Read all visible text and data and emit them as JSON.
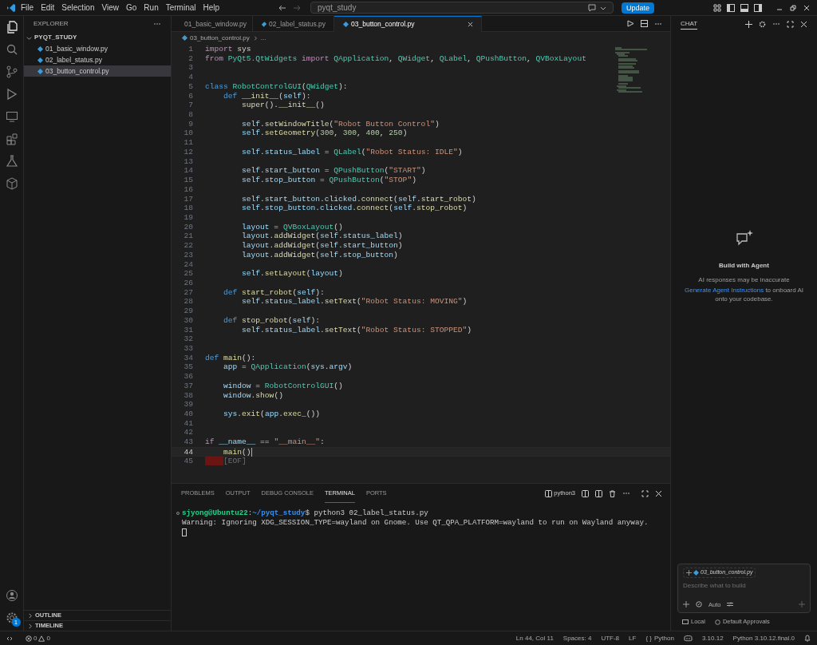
{
  "menu": [
    "File",
    "Edit",
    "Selection",
    "View",
    "Go",
    "Run",
    "Terminal",
    "Help"
  ],
  "search": {
    "value": "pyqt_study"
  },
  "update_button": "Update",
  "explorer": {
    "title": "EXPLORER",
    "folder": "PYQT_STUDY",
    "files": [
      {
        "name": "01_basic_window.py",
        "selected": false
      },
      {
        "name": "02_label_status.py",
        "selected": false
      },
      {
        "name": "03_button_control.py",
        "selected": true
      }
    ],
    "sections": [
      "OUTLINE",
      "TIMELINE"
    ]
  },
  "settings_badge": "1",
  "tabs": [
    {
      "label": "01_basic_window.py",
      "selected": false
    },
    {
      "label": "02_label_status.py",
      "selected": false
    },
    {
      "label": "03_button_control.py",
      "selected": true
    }
  ],
  "breadcrumb": [
    "03_button_control.py",
    "..."
  ],
  "code": [
    {
      "n": "1",
      "tokens": [
        {
          "kind": "kw",
          "text": "import"
        },
        {
          "kind": "pl",
          "text": " sys"
        }
      ]
    },
    {
      "n": "2",
      "tokens": [
        {
          "kind": "kw",
          "text": "from"
        },
        {
          "kind": "cl",
          "text": " PyQt5.QtWidgets "
        },
        {
          "kind": "kw",
          "text": "import"
        },
        {
          "kind": "cl",
          "text": " QApplication"
        },
        {
          "kind": "pl",
          "text": ", "
        },
        {
          "kind": "cl",
          "text": "QWidget"
        },
        {
          "kind": "pl",
          "text": ", "
        },
        {
          "kind": "cl",
          "text": "QLabel"
        },
        {
          "kind": "pl",
          "text": ", "
        },
        {
          "kind": "cl",
          "text": "QPushButton"
        },
        {
          "kind": "pl",
          "text": ", "
        },
        {
          "kind": "cl",
          "text": "QVBoxLayout"
        }
      ]
    },
    {
      "n": "3"
    },
    {
      "n": "4"
    },
    {
      "n": "5",
      "tokens": [
        {
          "kind": "st",
          "text": "class"
        },
        {
          "kind": "cl",
          "text": " RobotControlGUI"
        },
        {
          "kind": "pl",
          "text": "("
        },
        {
          "kind": "cl",
          "text": "QWidget"
        },
        {
          "kind": "pl",
          "text": "):"
        }
      ]
    },
    {
      "n": "6",
      "tokens": [
        {
          "kind": "st",
          "text": "    def"
        },
        {
          "kind": "fn",
          "text": " __init__"
        },
        {
          "kind": "pl",
          "text": "("
        },
        {
          "kind": "var",
          "text": "self"
        },
        {
          "kind": "pl",
          "text": "):"
        }
      ]
    },
    {
      "n": "7",
      "tokens": [
        {
          "kind": "fn",
          "text": "        super"
        },
        {
          "kind": "pl",
          "text": "()."
        },
        {
          "kind": "fn",
          "text": "__init__"
        },
        {
          "kind": "pl",
          "text": "()"
        }
      ]
    },
    {
      "n": "8"
    },
    {
      "n": "9",
      "tokens": [
        {
          "kind": "var",
          "text": "        self"
        },
        {
          "kind": "pl",
          "text": "."
        },
        {
          "kind": "fn",
          "text": "setWindowTitle"
        },
        {
          "kind": "pl",
          "text": "("
        },
        {
          "kind": "str",
          "text": "\"Robot Button Control\""
        },
        {
          "kind": "pl",
          "text": ")"
        }
      ]
    },
    {
      "n": "10",
      "tokens": [
        {
          "kind": "var",
          "text": "        self"
        },
        {
          "kind": "pl",
          "text": "."
        },
        {
          "kind": "fn",
          "text": "setGeometry"
        },
        {
          "kind": "pl",
          "text": "("
        },
        {
          "kind": "num",
          "text": "300"
        },
        {
          "kind": "pl",
          "text": ", "
        },
        {
          "kind": "num",
          "text": "300"
        },
        {
          "kind": "pl",
          "text": ", "
        },
        {
          "kind": "num",
          "text": "400"
        },
        {
          "kind": "pl",
          "text": ", "
        },
        {
          "kind": "num",
          "text": "250"
        },
        {
          "kind": "pl",
          "text": ")"
        }
      ]
    },
    {
      "n": "11"
    },
    {
      "n": "12",
      "tokens": [
        {
          "kind": "var",
          "text": "        self"
        },
        {
          "kind": "pl",
          "text": "."
        },
        {
          "kind": "var",
          "text": "status_label"
        },
        {
          "kind": "pl",
          "text": " = "
        },
        {
          "kind": "cl",
          "text": "QLabel"
        },
        {
          "kind": "pl",
          "text": "("
        },
        {
          "kind": "str",
          "text": "\"Robot Status: IDLE\""
        },
        {
          "kind": "pl",
          "text": ")"
        }
      ]
    },
    {
      "n": "13"
    },
    {
      "n": "14",
      "tokens": [
        {
          "kind": "var",
          "text": "        self"
        },
        {
          "kind": "pl",
          "text": "."
        },
        {
          "kind": "var",
          "text": "start_button"
        },
        {
          "kind": "pl",
          "text": " = "
        },
        {
          "kind": "cl",
          "text": "QPushButton"
        },
        {
          "kind": "pl",
          "text": "("
        },
        {
          "kind": "str",
          "text": "\"START\""
        },
        {
          "kind": "pl",
          "text": ")"
        }
      ]
    },
    {
      "n": "15",
      "tokens": [
        {
          "kind": "var",
          "text": "        self"
        },
        {
          "kind": "pl",
          "text": "."
        },
        {
          "kind": "var",
          "text": "stop_button"
        },
        {
          "kind": "pl",
          "text": " = "
        },
        {
          "kind": "cl",
          "text": "QPushButton"
        },
        {
          "kind": "pl",
          "text": "("
        },
        {
          "kind": "str",
          "text": "\"STOP\""
        },
        {
          "kind": "pl",
          "text": ")"
        }
      ]
    },
    {
      "n": "16"
    },
    {
      "n": "17",
      "tokens": [
        {
          "kind": "var",
          "text": "        self"
        },
        {
          "kind": "pl",
          "text": "."
        },
        {
          "kind": "var",
          "text": "start_button"
        },
        {
          "kind": "pl",
          "text": "."
        },
        {
          "kind": "var",
          "text": "clicked"
        },
        {
          "kind": "pl",
          "text": "."
        },
        {
          "kind": "fn",
          "text": "connect"
        },
        {
          "kind": "pl",
          "text": "("
        },
        {
          "kind": "var",
          "text": "self"
        },
        {
          "kind": "pl",
          "text": "."
        },
        {
          "kind": "fn",
          "text": "start_robot"
        },
        {
          "kind": "pl",
          "text": ")"
        }
      ]
    },
    {
      "n": "18",
      "tokens": [
        {
          "kind": "var",
          "text": "        self"
        },
        {
          "kind": "pl",
          "text": "."
        },
        {
          "kind": "var",
          "text": "stop_button"
        },
        {
          "kind": "pl",
          "text": "."
        },
        {
          "kind": "var",
          "text": "clicked"
        },
        {
          "kind": "pl",
          "text": "."
        },
        {
          "kind": "fn",
          "text": "connect"
        },
        {
          "kind": "pl",
          "text": "("
        },
        {
          "kind": "var",
          "text": "self"
        },
        {
          "kind": "pl",
          "text": "."
        },
        {
          "kind": "fn",
          "text": "stop_robot"
        },
        {
          "kind": "pl",
          "text": ")"
        }
      ]
    },
    {
      "n": "19"
    },
    {
      "n": "20",
      "tokens": [
        {
          "kind": "var",
          "text": "        layout"
        },
        {
          "kind": "pl",
          "text": " = "
        },
        {
          "kind": "cl",
          "text": "QVBoxLayout"
        },
        {
          "kind": "pl",
          "text": "()"
        }
      ]
    },
    {
      "n": "21",
      "tokens": [
        {
          "kind": "var",
          "text": "        layout"
        },
        {
          "kind": "pl",
          "text": "."
        },
        {
          "kind": "fn",
          "text": "addWidget"
        },
        {
          "kind": "pl",
          "text": "("
        },
        {
          "kind": "var",
          "text": "self"
        },
        {
          "kind": "pl",
          "text": "."
        },
        {
          "kind": "var",
          "text": "status_label"
        },
        {
          "kind": "pl",
          "text": ")"
        }
      ]
    },
    {
      "n": "22",
      "tokens": [
        {
          "kind": "var",
          "text": "        layout"
        },
        {
          "kind": "pl",
          "text": "."
        },
        {
          "kind": "fn",
          "text": "addWidget"
        },
        {
          "kind": "pl",
          "text": "("
        },
        {
          "kind": "var",
          "text": "self"
        },
        {
          "kind": "pl",
          "text": "."
        },
        {
          "kind": "var",
          "text": "start_button"
        },
        {
          "kind": "pl",
          "text": ")"
        }
      ]
    },
    {
      "n": "23",
      "tokens": [
        {
          "kind": "var",
          "text": "        layout"
        },
        {
          "kind": "pl",
          "text": "."
        },
        {
          "kind": "fn",
          "text": "addWidget"
        },
        {
          "kind": "pl",
          "text": "("
        },
        {
          "kind": "var",
          "text": "self"
        },
        {
          "kind": "pl",
          "text": "."
        },
        {
          "kind": "var",
          "text": "stop_button"
        },
        {
          "kind": "pl",
          "text": ")"
        }
      ]
    },
    {
      "n": "24"
    },
    {
      "n": "25",
      "tokens": [
        {
          "kind": "var",
          "text": "        self"
        },
        {
          "kind": "pl",
          "text": "."
        },
        {
          "kind": "fn",
          "text": "setLayout"
        },
        {
          "kind": "pl",
          "text": "("
        },
        {
          "kind": "var",
          "text": "layout"
        },
        {
          "kind": "pl",
          "text": ")"
        }
      ]
    },
    {
      "n": "26"
    },
    {
      "n": "27",
      "tokens": [
        {
          "kind": "st",
          "text": "    def"
        },
        {
          "kind": "fn",
          "text": " start_robot"
        },
        {
          "kind": "pl",
          "text": "("
        },
        {
          "kind": "var",
          "text": "self"
        },
        {
          "kind": "pl",
          "text": "):"
        }
      ]
    },
    {
      "n": "28",
      "tokens": [
        {
          "kind": "var",
          "text": "        self"
        },
        {
          "kind": "pl",
          "text": "."
        },
        {
          "kind": "var",
          "text": "status_label"
        },
        {
          "kind": "pl",
          "text": "."
        },
        {
          "kind": "fn",
          "text": "setText"
        },
        {
          "kind": "pl",
          "text": "("
        },
        {
          "kind": "str",
          "text": "\"Robot Status: MOVING\""
        },
        {
          "kind": "pl",
          "text": ")"
        }
      ]
    },
    {
      "n": "29"
    },
    {
      "n": "30",
      "tokens": [
        {
          "kind": "st",
          "text": "    def"
        },
        {
          "kind": "fn",
          "text": " stop_robot"
        },
        {
          "kind": "pl",
          "text": "("
        },
        {
          "kind": "var",
          "text": "self"
        },
        {
          "kind": "pl",
          "text": "):"
        }
      ]
    },
    {
      "n": "31",
      "tokens": [
        {
          "kind": "var",
          "text": "        self"
        },
        {
          "kind": "pl",
          "text": "."
        },
        {
          "kind": "var",
          "text": "status_label"
        },
        {
          "kind": "pl",
          "text": "."
        },
        {
          "kind": "fn",
          "text": "setText"
        },
        {
          "kind": "pl",
          "text": "("
        },
        {
          "kind": "str",
          "text": "\"Robot Status: STOPPED\""
        },
        {
          "kind": "pl",
          "text": ")"
        }
      ]
    },
    {
      "n": "32"
    },
    {
      "n": "33"
    },
    {
      "n": "34",
      "tokens": [
        {
          "kind": "st",
          "text": "def"
        },
        {
          "kind": "fn",
          "text": " main"
        },
        {
          "kind": "pl",
          "text": "():"
        }
      ]
    },
    {
      "n": "35",
      "tokens": [
        {
          "kind": "var",
          "text": "    app"
        },
        {
          "kind": "pl",
          "text": " = "
        },
        {
          "kind": "cl",
          "text": "QApplication"
        },
        {
          "kind": "pl",
          "text": "("
        },
        {
          "kind": "var",
          "text": "sys"
        },
        {
          "kind": "pl",
          "text": "."
        },
        {
          "kind": "var",
          "text": "argv"
        },
        {
          "kind": "pl",
          "text": ")"
        }
      ]
    },
    {
      "n": "36"
    },
    {
      "n": "37",
      "tokens": [
        {
          "kind": "var",
          "text": "    window"
        },
        {
          "kind": "pl",
          "text": " = "
        },
        {
          "kind": "cl",
          "text": "RobotControlGUI"
        },
        {
          "kind": "pl",
          "text": "()"
        }
      ]
    },
    {
      "n": "38",
      "tokens": [
        {
          "kind": "var",
          "text": "    window"
        },
        {
          "kind": "pl",
          "text": "."
        },
        {
          "kind": "fn",
          "text": "show"
        },
        {
          "kind": "pl",
          "text": "()"
        }
      ]
    },
    {
      "n": "39"
    },
    {
      "n": "40",
      "tokens": [
        {
          "kind": "var",
          "text": "    sys"
        },
        {
          "kind": "pl",
          "text": "."
        },
        {
          "kind": "fn",
          "text": "exit"
        },
        {
          "kind": "pl",
          "text": "("
        },
        {
          "kind": "var",
          "text": "app"
        },
        {
          "kind": "pl",
          "text": "."
        },
        {
          "kind": "fn",
          "text": "exec_"
        },
        {
          "kind": "pl",
          "text": "())"
        }
      ]
    },
    {
      "n": "41"
    },
    {
      "n": "42"
    },
    {
      "n": "43",
      "tokens": [
        {
          "kind": "kw",
          "text": "if"
        },
        {
          "kind": "var",
          "text": " __name__"
        },
        {
          "kind": "pl",
          "text": " == "
        },
        {
          "kind": "str",
          "text": "\"__main__\""
        },
        {
          "kind": "pl",
          "text": ":"
        }
      ]
    },
    {
      "n": "44",
      "current": true,
      "tokens": [
        {
          "kind": "fn",
          "text": "    main"
        },
        {
          "kind": "pl",
          "text": "()"
        }
      ]
    },
    {
      "n": "45",
      "eof": true,
      "tokens": [
        {
          "kind": "ghost",
          "text": "[EOF]"
        }
      ]
    }
  ],
  "panel": {
    "tabs": [
      {
        "label": "PROBLEMS",
        "selected": false
      },
      {
        "label": "OUTPUT",
        "selected": false
      },
      {
        "label": "DEBUG CONSOLE",
        "selected": false
      },
      {
        "label": "TERMINAL",
        "selected": true
      },
      {
        "label": "PORTS",
        "selected": false
      }
    ],
    "terminal_name": "python3",
    "terminal": {
      "user": "sjyong@Ubuntu22",
      "sep": ":",
      "path": "~/pyqt_study",
      "command": "$ python3 02_label_status.py",
      "output": "Warning: Ignoring XDG_SESSION_TYPE=wayland on Gnome. Use QT_QPA_PLATFORM=wayland to run on Wayland anyway."
    }
  },
  "chat": {
    "title": "CHAT",
    "heading": "Build with Agent",
    "note": "AI responses may be inaccurate",
    "link": "Generate Agent Instructions",
    "rest": "to onboard AI onto your codebase.",
    "attachment": "03_button_control.py",
    "input": {
      "placeholder": "Describe what to build"
    },
    "mode": "Auto",
    "location": "Local",
    "approvals": "Default Approvals"
  },
  "status_bar": {
    "errors": "0",
    "warnings": "0",
    "right": [
      "Ln 44, Col 11",
      "Spaces: 4",
      "UTF-8",
      "LF"
    ],
    "language_icon": "{ }",
    "language": "Python",
    "version": "3.10.12",
    "interpreter": "Python 3.10.12.final.0"
  }
}
